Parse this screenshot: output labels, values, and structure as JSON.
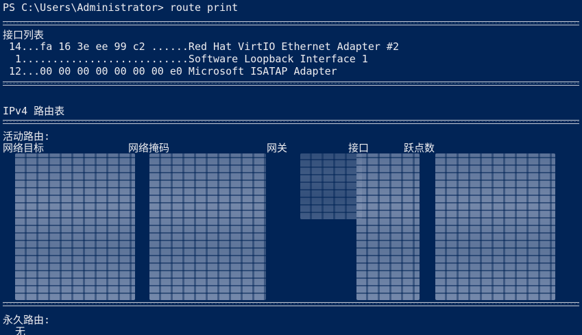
{
  "window": {
    "colors": {
      "background": "#012456",
      "text": "#EEEDF0",
      "separator": "#C9CCD6",
      "redacted": "#8d9dbb"
    }
  },
  "terminal": {
    "prompt_line": "PS C:\\Users\\Administrator> route print",
    "interface_list_title": "接口列表",
    "interfaces": [
      " 14...fa 16 3e ee 99 c2 ......Red Hat VirtIO Ethernet Adapter #2",
      "  1...........................Software Loopback Interface 1",
      " 12...00 00 00 00 00 00 00 e0 Microsoft ISATAP Adapter"
    ],
    "ipv4_route_table_title": "IPv4 路由表",
    "active_routes_label": "活动路由:",
    "columns": {
      "destination": "网络目标",
      "netmask": "网络掩码",
      "gateway": "网关",
      "interface": "接口",
      "metric": "跃点数"
    },
    "persistent_routes_label": "永久路由:",
    "persistent_routes_value": "  无"
  }
}
